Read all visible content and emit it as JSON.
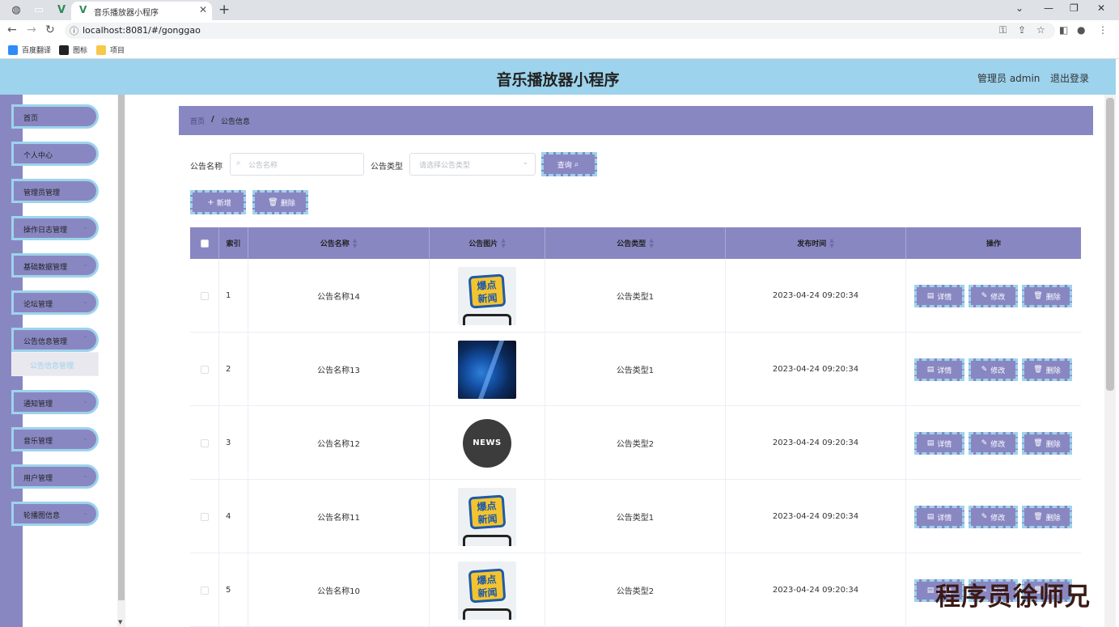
{
  "browser": {
    "tab_title": "音乐播放器小程序",
    "url": "localhost:8081/#/gonggao",
    "bookmarks": [
      "百度翻译",
      "图标",
      "项目"
    ]
  },
  "header": {
    "title": "音乐播放器小程序",
    "admin": "管理员 admin",
    "logout": "退出登录"
  },
  "sidebar": {
    "items": [
      {
        "label": "首页"
      },
      {
        "label": "个人中心"
      },
      {
        "label": "管理员管理"
      },
      {
        "label": "操作日志管理"
      },
      {
        "label": "基础数据管理"
      },
      {
        "label": "论坛管理"
      },
      {
        "label": "公告信息管理"
      },
      {
        "label": "通知管理"
      },
      {
        "label": "音乐管理"
      },
      {
        "label": "用户管理"
      },
      {
        "label": "轮播图信息"
      }
    ],
    "sub_item": "公告信息管理"
  },
  "breadcrumb": {
    "home": "首页",
    "sep": "/",
    "current": "公告信息"
  },
  "filters": {
    "name_label": "公告名称",
    "name_placeholder": "公告名称",
    "type_label": "公告类型",
    "type_placeholder": "请选择公告类型",
    "query_button": "查询"
  },
  "actions": {
    "add": "新增",
    "delete": "删除"
  },
  "table": {
    "headers": {
      "index": "索引",
      "name": "公告名称",
      "image": "公告图片",
      "type": "公告类型",
      "time": "发布时间",
      "ops": "操作"
    },
    "op_labels": {
      "detail": "详情",
      "edit": "修改",
      "delete": "删除"
    },
    "rows": [
      {
        "index": "1",
        "name": "公告名称14",
        "image": "burst",
        "type": "公告类型1",
        "time": "2023-04-24 09:20:34"
      },
      {
        "index": "2",
        "name": "公告名称13",
        "image": "globe",
        "type": "公告类型1",
        "time": "2023-04-24 09:20:34"
      },
      {
        "index": "3",
        "name": "公告名称12",
        "image": "news",
        "type": "公告类型2",
        "time": "2023-04-24 09:20:34"
      },
      {
        "index": "4",
        "name": "公告名称11",
        "image": "burst",
        "type": "公告类型1",
        "time": "2023-04-24 09:20:34"
      },
      {
        "index": "5",
        "name": "公告名称10",
        "image": "burst",
        "type": "公告类型2",
        "time": "2023-04-24 09:20:34"
      }
    ],
    "image_text": {
      "burst": "爆点 新闻",
      "news": "NEWS"
    }
  },
  "watermark": "程序员徐师兄",
  "colors": {
    "accent": "#8987c2",
    "header": "#9dd3ec",
    "dash": "#9dd3ec"
  }
}
